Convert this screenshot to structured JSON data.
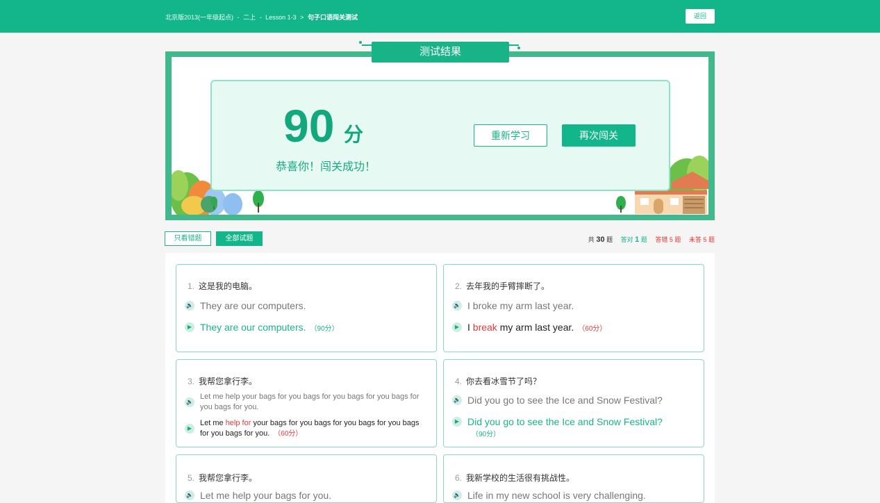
{
  "header": {
    "crumbs": [
      "北京版2013(一年级起点)",
      "二上",
      "Lesson 1-3"
    ],
    "crumb_seps": [
      "-",
      "-",
      ">"
    ],
    "current": "句子口语闯关测试",
    "back_label": "返回"
  },
  "result": {
    "tab_title": "测试结果",
    "score": "90",
    "score_unit": "分",
    "message": "恭喜你！闯关成功！",
    "relearn_label": "重新学习",
    "retry_label": "再次闯关"
  },
  "filters": {
    "wrong_only": "只看错题",
    "all": "全部试题"
  },
  "stats": {
    "total_prefix": "共",
    "total": "30",
    "total_suffix": "题",
    "correct_prefix": "答对",
    "correct": "1",
    "correct_suffix": "题",
    "wrong_prefix": "答错",
    "wrong": "5",
    "wrong_suffix": "题",
    "unanswered_prefix": "未答",
    "unanswered": "5",
    "unanswered_suffix": "题"
  },
  "questions": [
    {
      "num": "1.",
      "prompt": "这是我的电脑。",
      "reference": "They are our computers.",
      "answer": [
        "They are our computers."
      ],
      "score": "（90分）"
    },
    {
      "num": "2.",
      "prompt": "去年我的手臂摔断了。",
      "reference": "I broke my arm last year.",
      "answer": [
        "I ",
        "break",
        " my arm last year."
      ],
      "score": "（60分）"
    },
    {
      "num": "3.",
      "prompt": "我帮您拿行李。",
      "reference": "Let me help your bags for you  bags for you bags for you  bags for you  bags for you.",
      "answer": [
        "Let me ",
        "help for",
        " your bags for you  bags for you bags for you bags for you  bags for you."
      ],
      "score": "（60分）"
    },
    {
      "num": "4.",
      "prompt": "你去看冰雪节了吗？",
      "reference": "Did you go to see the Ice and Snow Festival?",
      "answer": [
        "Did you go to see the Ice and Snow Festival?"
      ],
      "score": "（90分）"
    },
    {
      "num": "5.",
      "prompt": "我帮您拿行李。",
      "reference": "Let me help your bags for you."
    },
    {
      "num": "6.",
      "prompt": "我新学校的生活很有挑战性。",
      "reference": "Life in my new school is very challenging."
    }
  ],
  "colors": {
    "brand": "#13b58a",
    "error": "#e03a3a",
    "score_green": "#13a77d"
  },
  "icons": {
    "audio": "speaker-icon",
    "play": "play-icon"
  }
}
